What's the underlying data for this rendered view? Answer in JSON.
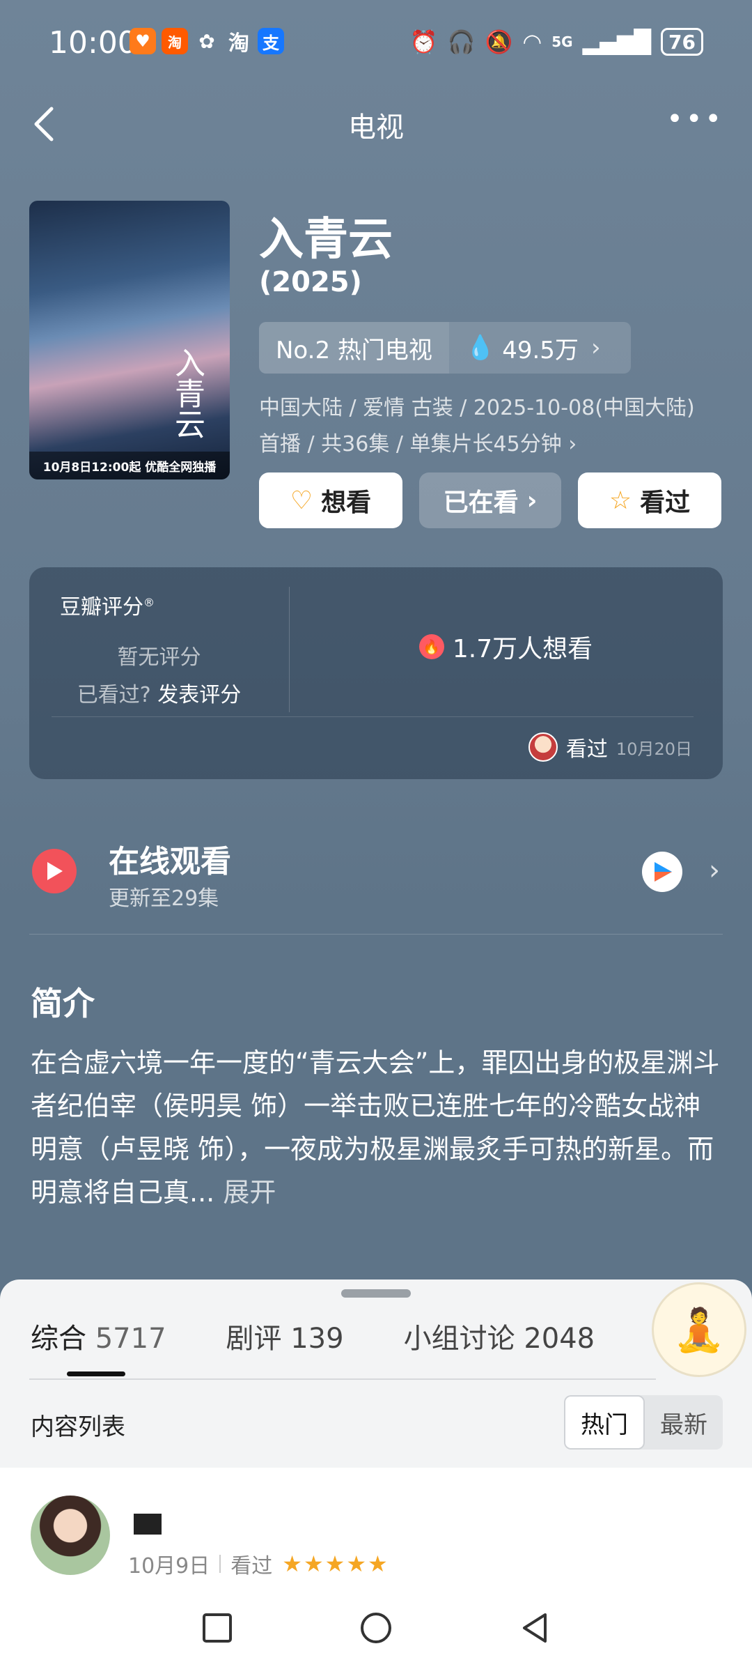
{
  "status_bar": {
    "time": "10:00",
    "battery": "76",
    "network": "5G",
    "app_icons": [
      {
        "name": "taobao-flash",
        "label": "淘",
        "color": "#ff6a00"
      },
      {
        "name": "heart-app",
        "label": "♥",
        "color": "#ff8a00"
      },
      {
        "name": "wechat",
        "label": "✿",
        "color": "#ffffff"
      },
      {
        "name": "taobao",
        "label": "淘",
        "color": "#ffffff"
      },
      {
        "name": "alipay",
        "label": "支",
        "color": "#1677ff"
      }
    ]
  },
  "nav": {
    "title": "电视",
    "back_icon": "chevron-left-icon",
    "more_icon": "more-horizontal-icon"
  },
  "poster": {
    "caption": "10月8日12:00起 优酷全网独播",
    "overlay_title": "入青云"
  },
  "show": {
    "title": "入青云",
    "year": "(2025)",
    "rank": "No.2 热门电视",
    "heat": "49.5万",
    "meta_line1": "中国大陆 / 爱情 古装 / 2025-10-08(中国大陆)",
    "meta_line2": "首播 / 共36集 / 单集片长45分钟",
    "buttons": {
      "want": "想看",
      "watching": "已在看",
      "watched": "看过"
    }
  },
  "rating": {
    "title": "豆瓣评分",
    "title_mark": "®",
    "no_rating": "暂无评分",
    "seen_prompt": "已看过?",
    "post_rating": "发表评分",
    "want_count": "1.7万人想看",
    "friend_status": "看过",
    "friend_date": "10月20日"
  },
  "online": {
    "title": "在线观看",
    "subtitle": "更新至29集"
  },
  "intro": {
    "heading": "简介",
    "text": "在合虚六境一年一度的“青云大会”上，罪囚出身的极星渊斗者纪伯宰（侯明昊 饰）一举击败已连胜七年的冷酷女战神明意（卢昱晓 饰），一夜成为极星渊最炙手可热的新星。而明意将自己真...",
    "expand": "展开"
  },
  "sheet": {
    "tabs": [
      {
        "label": "综合",
        "count": "5717"
      },
      {
        "label": "剧评",
        "count": "139"
      },
      {
        "label": "小组讨论",
        "count": "2048"
      }
    ],
    "list_title": "内容列表",
    "sort": {
      "hot": "热门",
      "new": "最新"
    }
  },
  "post": {
    "date": "10月9日",
    "status": "看过",
    "stars": "★★★★★"
  },
  "colors": {
    "accent_red": "#f2525a",
    "star": "#f5a623"
  }
}
